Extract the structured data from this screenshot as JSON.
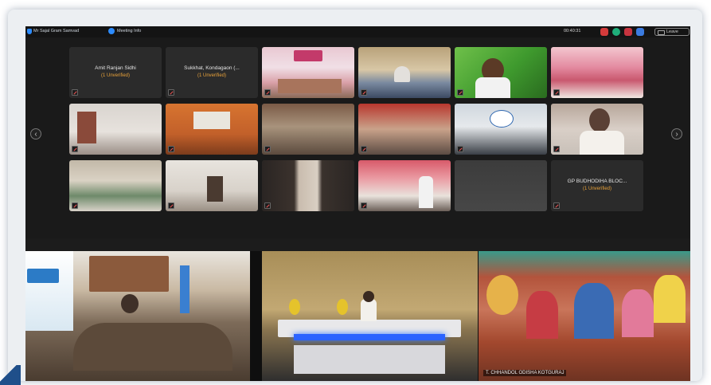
{
  "titlebar": {
    "meeting_title": "Mr Sajal Gram Samvad",
    "meeting_info_label": "Meeting Info",
    "time": "00:40:31",
    "leave_label": "Leave"
  },
  "gallery": {
    "tiles": [
      {
        "name": "Amit Ranjan Sidhi",
        "status": "(1 Unverified)",
        "camera": "off"
      },
      {
        "name": "Sukkhat, Kondagaon (...",
        "status": "(1 Unverified)",
        "camera": "off"
      },
      {
        "name": "",
        "status": "",
        "camera": "on",
        "scene": "pink-banner-room"
      },
      {
        "name": "",
        "status": "",
        "camera": "on",
        "scene": "office-desk"
      },
      {
        "name": "",
        "status": "",
        "camera": "on",
        "scene": "man-green-bg"
      },
      {
        "name": "",
        "status": "",
        "camera": "on",
        "scene": "pink-hall"
      },
      {
        "name": "",
        "status": "",
        "camera": "on",
        "scene": "empty-room"
      },
      {
        "name": "",
        "status": "",
        "camera": "on",
        "scene": "orange-room-screen"
      },
      {
        "name": "",
        "status": "",
        "camera": "on",
        "scene": "office-chairs"
      },
      {
        "name": "",
        "status": "",
        "camera": "on",
        "scene": "red-wall-meeting"
      },
      {
        "name": "",
        "status": "",
        "camera": "on",
        "scene": "desk-poster"
      },
      {
        "name": "",
        "status": "",
        "camera": "on",
        "scene": "elderly-man"
      },
      {
        "name": "",
        "status": "",
        "camera": "on",
        "scene": "conference-table"
      },
      {
        "name": "",
        "status": "",
        "camera": "on",
        "scene": "plain-room"
      },
      {
        "name": "",
        "status": "",
        "camera": "on",
        "scene": "dark-door"
      },
      {
        "name": "",
        "status": "",
        "camera": "on",
        "scene": "group-standing"
      },
      {
        "name": "",
        "status": "",
        "camera": "on",
        "scene": "blank-grey"
      },
      {
        "name": "GP BUDHODIHA BLOC...",
        "status": "(1 Unverified)",
        "camera": "off"
      }
    ]
  },
  "feeds": {
    "left_scene": "ministry-conference",
    "center_scene": "studio-desk",
    "right_label": "T. CHHANDOL ODISHA KOTGURAJ",
    "right_scene": "women-gathering"
  },
  "colors": {
    "accent": "#2d8cff",
    "unverified": "#e8a23a",
    "active_border": "#27c2a7"
  }
}
